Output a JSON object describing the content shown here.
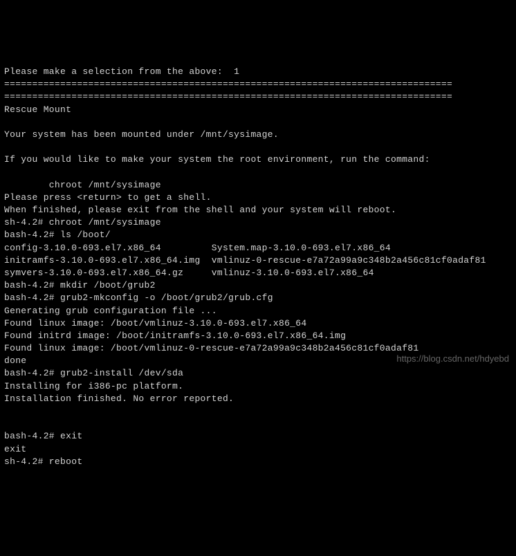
{
  "lines": {
    "l0": "Please make a selection from the above:  1",
    "l1": "================================================================================",
    "l2": "================================================================================",
    "l3": "Rescue Mount",
    "l4": "",
    "l5": "Your system has been mounted under /mnt/sysimage.",
    "l6": "",
    "l7": "If you would like to make your system the root environment, run the command:",
    "l8": "",
    "l9": "        chroot /mnt/sysimage",
    "l10": "Please press <return> to get a shell.",
    "l11": "When finished, please exit from the shell and your system will reboot.",
    "l12": "sh-4.2# chroot /mnt/sysimage",
    "l13": "bash-4.2# ls /boot/",
    "l14": "config-3.10.0-693.el7.x86_64         System.map-3.10.0-693.el7.x86_64",
    "l15": "initramfs-3.10.0-693.el7.x86_64.img  vmlinuz-0-rescue-e7a72a99a9c348b2a456c81cf0adaf81",
    "l16": "symvers-3.10.0-693.el7.x86_64.gz     vmlinuz-3.10.0-693.el7.x86_64",
    "l17": "bash-4.2# mkdir /boot/grub2",
    "l18": "bash-4.2# grub2-mkconfig -o /boot/grub2/grub.cfg",
    "l19": "Generating grub configuration file ...",
    "l20": "Found linux image: /boot/vmlinuz-3.10.0-693.el7.x86_64",
    "l21": "Found initrd image: /boot/initramfs-3.10.0-693.el7.x86_64.img",
    "l22": "Found linux image: /boot/vmlinuz-0-rescue-e7a72a99a9c348b2a456c81cf0adaf81",
    "l23": "done",
    "l24": "bash-4.2# grub2-install /dev/sda",
    "l25": "Installing for i386-pc platform.",
    "l26": "Installation finished. No error reported.",
    "l27": "",
    "l28": "",
    "l29": "bash-4.2# exit",
    "l30": "exit",
    "l31": "sh-4.2# reboot"
  },
  "watermark": "https://blog.csdn.net/hdyebd"
}
